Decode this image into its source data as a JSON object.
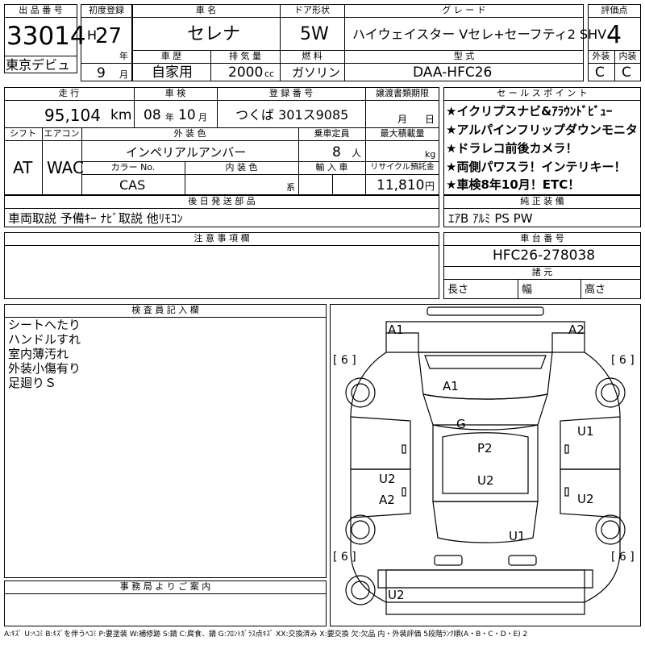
{
  "header": {
    "lot_no_label": "出 品 番 号",
    "lot_no": "33014",
    "first_reg_label": "初度登録",
    "era": "H",
    "year": "27",
    "year_unit": "年",
    "month": "9",
    "month_unit": "月",
    "debut": "東京デビュ",
    "car_name_label": "車 名",
    "car_name": "セレナ",
    "door_label": "ドア形状",
    "door": "5W",
    "grade_label": "グ レ ー ド",
    "grade": "ハイウェイスター Vセレ+セーフティ2 SHV",
    "score_label": "評価点",
    "score": "4",
    "history_label": "車 歴",
    "history": "自家用",
    "displacement_label": "排 気 量",
    "displacement": "2000",
    "displacement_unit": "cc",
    "fuel_label": "燃 料",
    "fuel": "ガソリン",
    "model_label": "型 式",
    "model": "DAA-HFC26",
    "exterior_label": "外装",
    "exterior": "C",
    "interior_label": "内装",
    "interior": "C"
  },
  "row2": {
    "mileage_label": "走 行",
    "mileage": "95,104",
    "mileage_unit": "km",
    "inspection_label": "車 検",
    "insp_year": "08",
    "insp_year_unit": "年",
    "insp_month": "10",
    "insp_month_unit": "月",
    "plate_label": "登 録 番 号",
    "plate": "つくば 301ス9085",
    "transfer_label": "譲渡書類期限",
    "transfer_month_unit": "月",
    "transfer_day_unit": "日",
    "shift_label": "シフト",
    "shift": "AT",
    "ac_label": "エアコン",
    "ac": "WAC",
    "color_label": "外 装 色",
    "color": "インペリアルアンバー",
    "capacity_label": "乗車定員",
    "capacity": "8",
    "capacity_unit": "人",
    "load_label": "最大積載量",
    "load_unit": "kg",
    "color_no_label": "カラー No.",
    "color_no": "CAS",
    "int_color_label": "内 装 色",
    "int_color_unit": "系",
    "import_label": "輸 入 車",
    "recycle_label": "リサイクル預託金",
    "recycle": "11,810",
    "recycle_unit": "円"
  },
  "selling_points": {
    "label": "セ ー ル ス ポ イ ン ト",
    "items": [
      "★イクリプスナビ&ｱﾗｳﾝﾄﾞﾋﾞｭｰ",
      "★アルパインフリップダウンモニタ",
      "★ドラレコ前後カメラ！",
      "★両側パワスラ！インテリキー！",
      "★車検8年10月！ETC！"
    ]
  },
  "later_parts": {
    "label": "後 日 発 送 部 品",
    "text": "車両取説 予備ｷｰ ﾅﾋﾞ取説 他ﾘﾓｺﾝ"
  },
  "standard_equipment": {
    "label": "純 正 装 備",
    "text": "ｴｱB ｱﾙﾐ PS PW"
  },
  "notes": {
    "label": "注 意 事 項 欄"
  },
  "chassis": {
    "label": "車 台 番 号",
    "number": "HFC26-278038"
  },
  "dimensions": {
    "label": "諸 元",
    "length": "長さ",
    "width": "幅",
    "height": "高さ"
  },
  "inspector": {
    "label": "検 査 員 記 入 欄",
    "lines": [
      "シートへたり",
      "ハンドルすれ",
      "室内薄汚れ",
      "外装小傷有り",
      "足廻りＳ"
    ]
  },
  "office": {
    "label": "事 務 局 よ り ご 案 内"
  },
  "diagram": {
    "marks": {
      "a1_top": "A1",
      "a2_top": "A2",
      "a1_hood": "A1",
      "g": "G",
      "p2": "P2",
      "u1_right": "U1",
      "u2_left": "U2",
      "u2_center": "U2",
      "a2_left": "A2",
      "u2_right": "U2",
      "u1_bottom": "U1",
      "u2_rear": "U2"
    },
    "tires": [
      "[ 6 ]",
      "[ 6 ]",
      "[ 6 ]",
      "[ 6 ]"
    ]
  },
  "legend": "A:ｷｽﾞ U:ﾍｺﾐ B:ｷｽﾞを伴うﾍｺﾐ P:要塗装 W:補修跡 S:錆 C:腐食、錆 G:ﾌﾛﾝﾄｶﾞﾗｽ点ｷｽﾞ XX:交換済み X:要交換 欠:欠品 内・外装評価 5段階ﾗﾝｸ順(A・B・C・D・E) 2"
}
